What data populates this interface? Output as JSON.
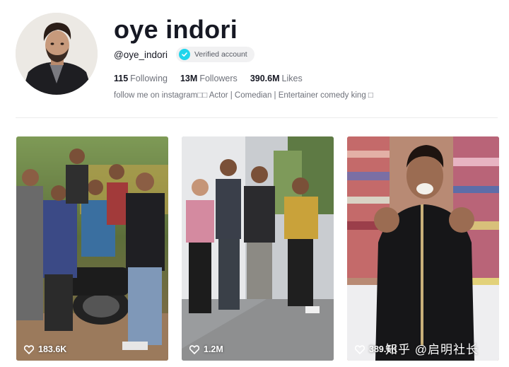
{
  "profile": {
    "title": "oye indori",
    "handle": "@oye_indori",
    "verified_label": "Verified account",
    "bio": "follow me on instagram□□ Actor | Comedian | Entertainer comedy king □"
  },
  "stats": [
    {
      "value": "115",
      "label": "Following"
    },
    {
      "value": "13M",
      "label": "Followers"
    },
    {
      "value": "390.6M",
      "label": "Likes"
    }
  ],
  "videos": [
    {
      "likes": "183.6K"
    },
    {
      "likes": "1.2M"
    },
    {
      "likes": "389.6K"
    }
  ],
  "watermark": "知乎 @启明社长",
  "colors": {
    "verified_badge": "#20d5ec",
    "title_text": "#161823",
    "secondary_text": "#6e717a"
  },
  "icons": {
    "verified": "check-badge-icon",
    "likes": "heart-outline-icon"
  }
}
